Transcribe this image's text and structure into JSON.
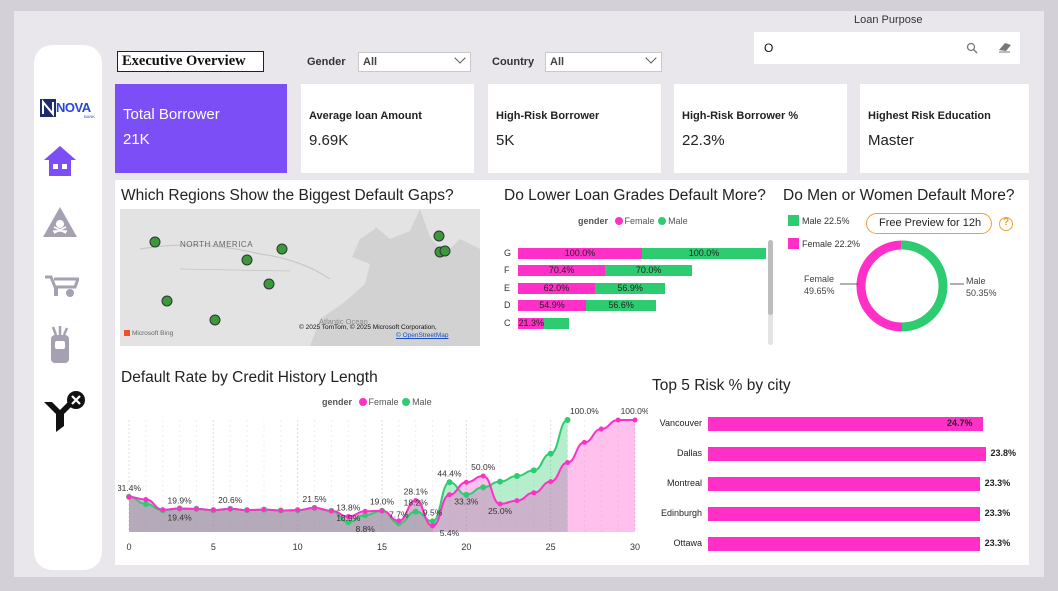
{
  "header": {
    "title": "Executive Overview",
    "gender_label": "Gender",
    "gender_value": "All",
    "country_label": "Country",
    "country_value": "All",
    "loan_purpose_label": "Loan Purpose",
    "loan_purpose_value": "O"
  },
  "sidebar": {
    "logo_text": "NOVA",
    "logo_sub": "BANK"
  },
  "kpis": [
    {
      "label": "Total Borrower",
      "value": "21K"
    },
    {
      "label": "Average loan Amount",
      "value": "9.69K"
    },
    {
      "label": "High-Risk Borrower",
      "value": "5K"
    },
    {
      "label": "High-Risk Borrower %",
      "value": "22.3%"
    },
    {
      "label": "Highest Risk Education",
      "value": "Master"
    }
  ],
  "map": {
    "title": "Which Regions Show the Biggest Default Gaps?",
    "region_label": "NORTH AMERICA",
    "ocean_label": "Atlantic Ocean",
    "credit": "© 2025 TomTom, © 2025 Microsoft Corporation,",
    "credit_link": "© OpenStreetMap",
    "brand": "Microsoft Bing"
  },
  "grades": {
    "title": "Do Lower Loan Grades Default More?",
    "legend_title": "gender",
    "legend_female": "Female",
    "legend_male": "Male"
  },
  "gender_donut": {
    "title": "Do Men or Women Default More?",
    "male_legend": "Male 22.5%",
    "female_legend": "Female 22.2%",
    "preview_button": "Free Preview for 12h",
    "help": "?",
    "female_label": "Female",
    "female_pct": "49.65%",
    "male_label": "Male",
    "male_pct": "50.35%"
  },
  "credit_history": {
    "title": "Default Rate by Credit History Length",
    "legend_title": "gender",
    "legend_female": "Female",
    "legend_male": "Male"
  },
  "cities": {
    "title": "Top 5 Risk % by city"
  },
  "colors": {
    "accent": "#7b4ff5",
    "female": "#ff2fc8",
    "male": "#2ecc71"
  },
  "chart_data": [
    {
      "type": "bar",
      "id": "grades",
      "orientation": "horizontal-stacked",
      "categories": [
        "G",
        "F",
        "E",
        "D",
        "C"
      ],
      "series": [
        {
          "name": "Female",
          "values": [
            100.0,
            70.4,
            62.0,
            54.9,
            21.3
          ],
          "labels": [
            "100.0%",
            "70.4%",
            "62.0%",
            "54.9%",
            "21.3%"
          ]
        },
        {
          "name": "Male",
          "values": [
            100.0,
            70.0,
            56.9,
            56.6,
            20.0
          ],
          "labels": [
            "100.0%",
            "70.0%",
            "56.9%",
            "56.6%",
            ""
          ]
        }
      ]
    },
    {
      "type": "pie",
      "id": "gender_donut",
      "categories": [
        "Female",
        "Male"
      ],
      "values": [
        49.65,
        50.35
      ]
    },
    {
      "type": "line",
      "id": "credit_history",
      "x": [
        0,
        1,
        2,
        3,
        4,
        5,
        6,
        7,
        8,
        9,
        10,
        11,
        12,
        13,
        14,
        15,
        16,
        17,
        18,
        19,
        20,
        21,
        22,
        23,
        24,
        25,
        26,
        27,
        28,
        29,
        30
      ],
      "xticks": [
        "0",
        "5",
        "10",
        "15",
        "20",
        "25",
        "30"
      ],
      "xlim": [
        0,
        30
      ],
      "series": [
        {
          "name": "Female",
          "values": [
            31.4,
            29,
            19.9,
            21,
            20.6,
            19.5,
            20.6,
            19.5,
            20,
            19.2,
            19.5,
            21.5,
            18.9,
            13.8,
            18.5,
            19.0,
            10,
            28.1,
            5.4,
            33.3,
            44.4,
            50.0,
            25.0,
            28,
            35,
            45,
            62,
            80,
            92,
            100.0,
            100.0
          ]
        },
        {
          "name": "Male",
          "values": [
            31.4,
            25,
            19.4,
            21,
            20.6,
            19.5,
            20.6,
            19.5,
            20,
            19.2,
            19.5,
            21.5,
            18.9,
            8.8,
            15,
            19.0,
            7.7,
            18.2,
            9.5,
            44.4,
            33.3,
            40,
            45,
            50,
            55,
            70,
            100.0,
            null,
            null,
            null,
            null
          ]
        }
      ],
      "annotations": [
        {
          "x": 0,
          "y": 31.4,
          "text": "31.4%"
        },
        {
          "x": 3,
          "y": 19.9,
          "text": "19.9%"
        },
        {
          "x": 3,
          "y": 19.4,
          "text": "19.4%"
        },
        {
          "x": 6,
          "y": 20.6,
          "text": "20.6%"
        },
        {
          "x": 11,
          "y": 21.5,
          "text": "21.5%"
        },
        {
          "x": 13,
          "y": 13.8,
          "text": "13.8%"
        },
        {
          "x": 13,
          "y": 18.9,
          "text": "18.9%"
        },
        {
          "x": 14,
          "y": 8.8,
          "text": "8.8%"
        },
        {
          "x": 15,
          "y": 19.0,
          "text": "19.0%"
        },
        {
          "x": 16,
          "y": 7.7,
          "text": "7.7%"
        },
        {
          "x": 17,
          "y": 28.1,
          "text": "28.1%"
        },
        {
          "x": 17,
          "y": 18.2,
          "text": "18.2%"
        },
        {
          "x": 18,
          "y": 9.5,
          "text": "9.5%"
        },
        {
          "x": 19,
          "y": 44.4,
          "text": "44.4%"
        },
        {
          "x": 19,
          "y": 5.4,
          "text": "5.4%"
        },
        {
          "x": 20,
          "y": 33.3,
          "text": "33.3%"
        },
        {
          "x": 21,
          "y": 50.0,
          "text": "50.0%"
        },
        {
          "x": 22,
          "y": 25.0,
          "text": "25.0%"
        },
        {
          "x": 27,
          "y": 100.0,
          "text": "100.0%"
        },
        {
          "x": 30,
          "y": 100.0,
          "text": "100.0%"
        }
      ]
    },
    {
      "type": "bar",
      "id": "cities",
      "orientation": "horizontal",
      "categories": [
        "Vancouver",
        "Dallas",
        "Montreal",
        "Edinburgh",
        "Ottawa"
      ],
      "values": [
        24.7,
        23.8,
        23.3,
        23.3,
        23.3
      ],
      "labels": [
        "24.7%",
        "23.8%",
        "23.3%",
        "23.3%",
        "23.3%"
      ]
    }
  ]
}
